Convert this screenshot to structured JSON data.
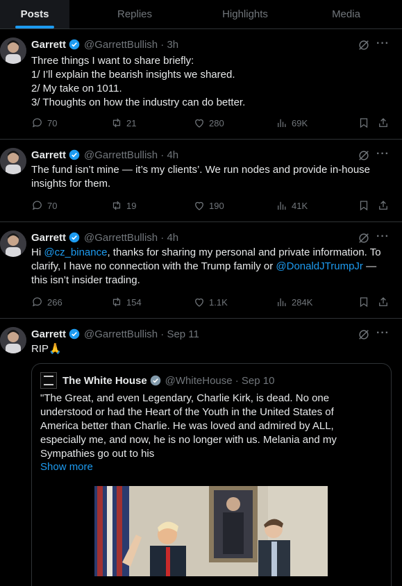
{
  "tabs": [
    {
      "label": "Posts",
      "active": true
    },
    {
      "label": "Replies",
      "active": false
    },
    {
      "label": "Highlights",
      "active": false
    },
    {
      "label": "Media",
      "active": false
    }
  ],
  "posts": [
    {
      "name": "Garrett",
      "handle_time": "@GarrettBullish · 3h",
      "lines": [
        "Three things I want to share briefly:",
        "1/ I’ll explain the bearish insights we shared.",
        "2/ My take on 1011.",
        "3/ Thoughts on how the industry can do better."
      ],
      "replies": "70",
      "reposts": "21",
      "likes": "280",
      "views": "69K"
    },
    {
      "name": "Garrett",
      "handle_time": "@GarrettBullish · 4h",
      "lines": [
        "The fund isn’t mine — it’s my clients’. We run nodes and provide in-house",
        "insights for them."
      ],
      "replies": "70",
      "reposts": "19",
      "likes": "190",
      "views": "41K"
    },
    {
      "name": "Garrett",
      "handle_time": "@GarrettBullish · 4h",
      "text_parts": {
        "a": "Hi ",
        "mention1": "@cz_binance",
        "b": ", thanks for sharing my personal and private information. To",
        "c": "clarify, I have no connection with the Trump family or ",
        "mention2": "@DonaldJTrumpJr",
        "d": " —",
        "e": "this isn’t insider trading."
      },
      "replies": "266",
      "reposts": "154",
      "likes": "1.1K",
      "views": "284K"
    },
    {
      "name": "Garrett",
      "handle_time": "@GarrettBullish · Sep 11",
      "text": "RIP🙏",
      "quote": {
        "name": "The White House",
        "handle_time": "@WhiteHouse · Sep 10",
        "lines": [
          "\"The Great, and even Legendary, Charlie Kirk, is dead. No one",
          "understood or had the Heart of the Youth in the United States of",
          "America better than Charlie. He was loved and admired by ALL,",
          "especially me, and now, he is no longer with us. Melania and my",
          "Sympathies go out to his"
        ],
        "show_more": "Show more"
      }
    }
  ],
  "colors": {
    "accent": "#1d9bf0",
    "muted": "#71767b",
    "text": "#e7e9ea",
    "border": "#2f3336",
    "verified": "#1d9bf0",
    "gov_badge": "#829aab"
  },
  "icons": [
    "verified-badge-icon",
    "grok-icon",
    "more-icon",
    "reply-icon",
    "repost-icon",
    "like-icon",
    "views-icon",
    "bookmark-icon",
    "share-icon",
    "gov-badge-icon"
  ]
}
